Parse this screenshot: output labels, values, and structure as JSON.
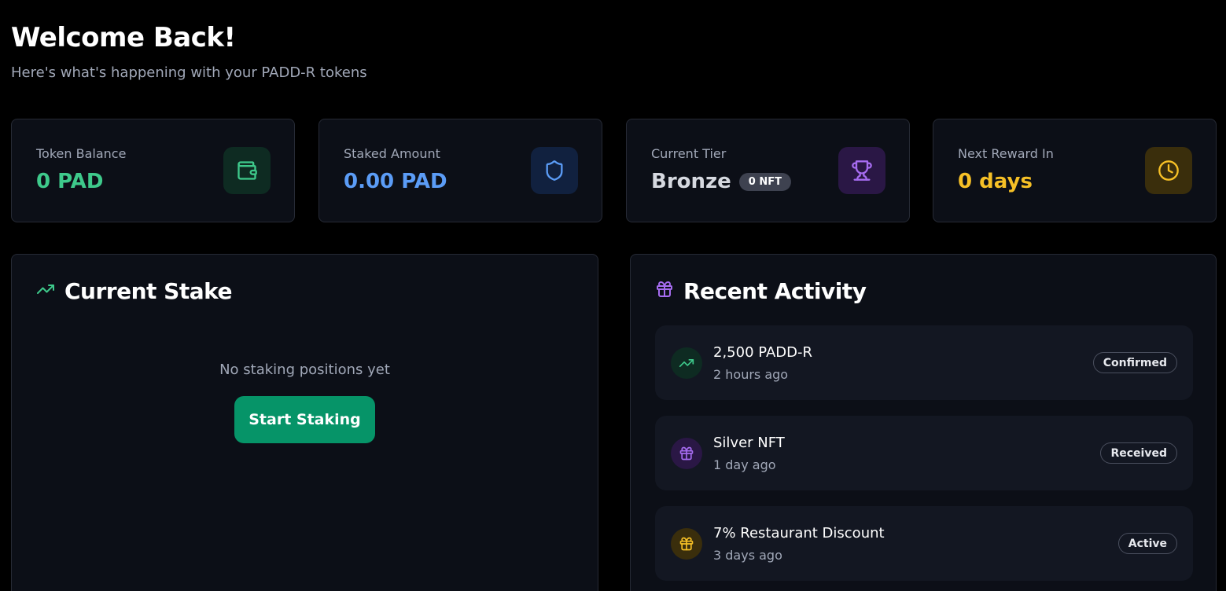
{
  "header": {
    "title": "Welcome Back!",
    "subtitle": "Here's what's happening with your PADD-R tokens"
  },
  "stats": [
    {
      "label": "Token Balance",
      "value": "0 PAD",
      "icon": "wallet-icon",
      "color": "#3ec98b"
    },
    {
      "label": "Staked Amount",
      "value": "0.00 PAD",
      "icon": "shield-icon",
      "color": "#5b9cf6"
    },
    {
      "label": "Current Tier",
      "value": "Bronze",
      "badge": "0 NFT",
      "icon": "trophy-icon",
      "color": "#d6d9e0"
    },
    {
      "label": "Next Reward In",
      "value": "0 days",
      "icon": "clock-icon",
      "color": "#f6c026"
    }
  ],
  "current_stake": {
    "title": "Current Stake",
    "empty_text": "No staking positions yet",
    "button_label": "Start Staking"
  },
  "recent_activity": {
    "title": "Recent Activity",
    "items": [
      {
        "title": "2,500 PADD-R",
        "time": "2 hours ago",
        "status": "Confirmed",
        "icon": "trending-up-icon"
      },
      {
        "title": "Silver NFT",
        "time": "1 day ago",
        "status": "Received",
        "icon": "gift-icon"
      },
      {
        "title": "7% Restaurant Discount",
        "time": "3 days ago",
        "status": "Active",
        "icon": "gift-icon"
      }
    ]
  },
  "colors": {
    "green": "#3ec98b",
    "blue": "#5b9cf6",
    "purple": "#a66cf0",
    "yellow": "#f6c026",
    "button": "#069468"
  }
}
